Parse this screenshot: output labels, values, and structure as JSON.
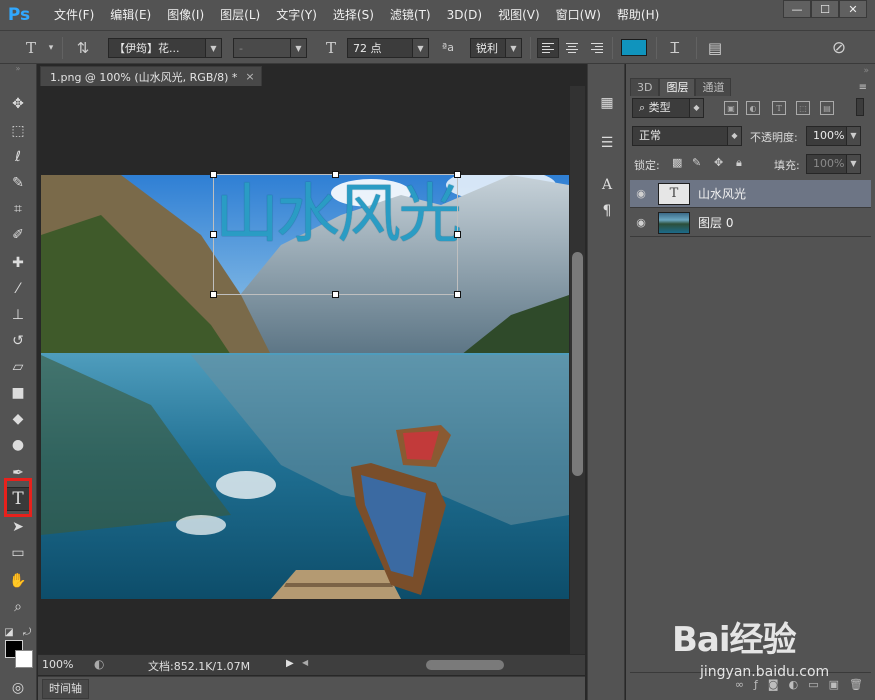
{
  "app": {
    "logo": "Ps"
  },
  "menu": [
    "文件(F)",
    "编辑(E)",
    "图像(I)",
    "图层(L)",
    "文字(Y)",
    "选择(S)",
    "滤镜(T)",
    "3D(D)",
    "视图(V)",
    "窗口(W)",
    "帮助(H)"
  ],
  "window_controls": {
    "minimize": "—",
    "maximize": "☐",
    "close": "✕"
  },
  "options": {
    "font_family": "【伊筠】花...",
    "font_style": "-",
    "font_size": "72 点",
    "aa_label": "ªa",
    "antialias": "锐利",
    "text_color": "#1094bd"
  },
  "document": {
    "tab_title": "1.png @ 100% (山水风光, RGB/8) *",
    "close": "×",
    "text_content": "山水风光",
    "text_color": "#2a9cc4"
  },
  "status": {
    "zoom": "100%",
    "doc_info": "文档:852.1K/1.07M"
  },
  "timeline": {
    "label": "时间轴"
  },
  "layers_panel": {
    "tabs": [
      {
        "label": "3D"
      },
      {
        "label": "图层"
      },
      {
        "label": "通道"
      }
    ],
    "filter_kind": "类型",
    "blend_mode": "正常",
    "opacity_label": "不透明度:",
    "opacity_value": "100%",
    "lock_label": "锁定:",
    "fill_label": "填充:",
    "fill_value": "100%",
    "layers": [
      {
        "name": "山水风光",
        "type": "text",
        "thumb": "T"
      },
      {
        "name": "图层 0",
        "type": "image"
      }
    ]
  },
  "watermark": {
    "logo": "Bai经验",
    "url": "jingyan.baidu.com"
  }
}
